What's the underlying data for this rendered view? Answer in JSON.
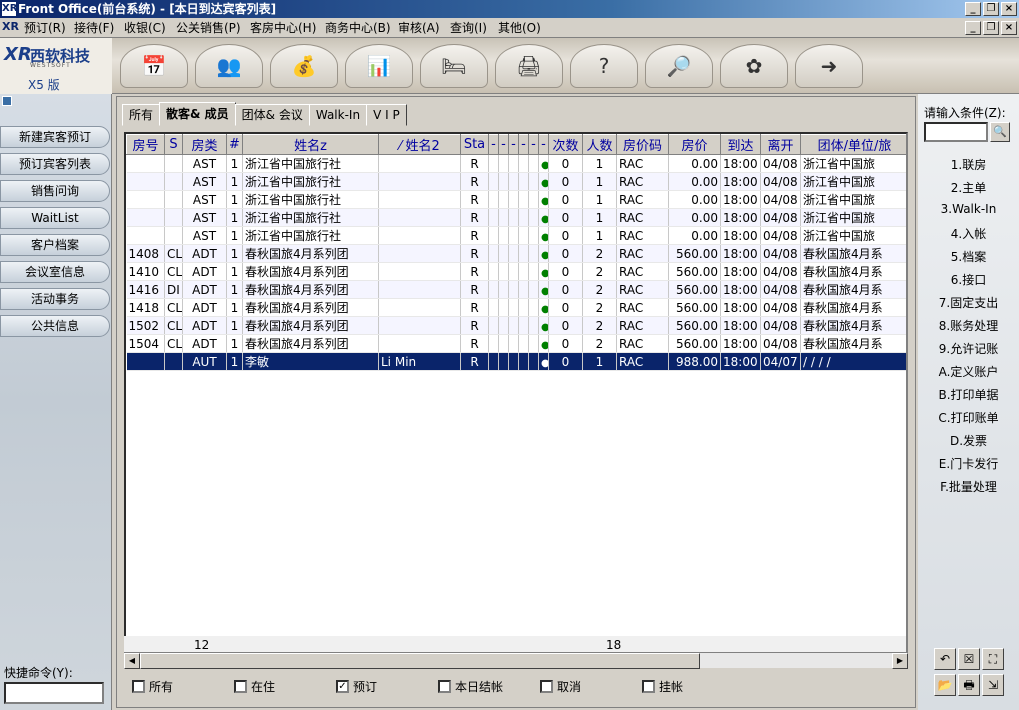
{
  "window": {
    "title": "Front Office(前台系统) - [本日到达宾客列表]"
  },
  "menu": [
    "预订(R)",
    "接待(F)",
    "收银(C)",
    "公关销售(P)",
    "客房中心(H)",
    "商务中心(B)",
    "审核(A)",
    "查询(I)",
    "其他(O)"
  ],
  "brand": {
    "name": "西软科技",
    "sub": "WESTSOFT",
    "version": "X5 版"
  },
  "toolbar_icons": [
    "reservation-icon",
    "reception-icon",
    "cashier-icon",
    "report-chart-icon",
    "room-bed-icon",
    "business-printer-icon",
    "help-icon",
    "search-query-icon",
    "settings-flower-icon",
    "exit-icon"
  ],
  "left_nav": [
    "新建宾客预订",
    "预订宾客列表",
    "销售问询",
    "WaitList",
    "客户档案",
    "会议室信息",
    "活动事务",
    "公共信息"
  ],
  "quick_cmd_label": "快捷命令(Y):",
  "tabs": [
    "所有",
    "散客& 成员",
    "团体& 会议",
    "Walk-In",
    "V I P"
  ],
  "columns": [
    "房号",
    "S",
    "房类",
    "#",
    "姓名z",
    "⁄ 姓名2",
    "Sta",
    "-",
    "-",
    "-",
    "-",
    "-",
    "-",
    "次数",
    "人数",
    "房价码",
    "房价",
    "到达",
    "离开",
    "团体/单位/旅"
  ],
  "rows": [
    {
      "room": "",
      "s": "",
      "type": "AST",
      "n": "1",
      "name": "浙江省中国旅行社",
      "name2": "",
      "sta": "R",
      "times": "0",
      "persons": "1",
      "code": "RAC",
      "rate": "0.00",
      "arr": "18:00",
      "dep": "04/08",
      "group": "浙江省中国旅"
    },
    {
      "room": "",
      "s": "",
      "type": "AST",
      "n": "1",
      "name": "浙江省中国旅行社",
      "name2": "",
      "sta": "R",
      "times": "0",
      "persons": "1",
      "code": "RAC",
      "rate": "0.00",
      "arr": "18:00",
      "dep": "04/08",
      "group": "浙江省中国旅"
    },
    {
      "room": "",
      "s": "",
      "type": "AST",
      "n": "1",
      "name": "浙江省中国旅行社",
      "name2": "",
      "sta": "R",
      "times": "0",
      "persons": "1",
      "code": "RAC",
      "rate": "0.00",
      "arr": "18:00",
      "dep": "04/08",
      "group": "浙江省中国旅"
    },
    {
      "room": "",
      "s": "",
      "type": "AST",
      "n": "1",
      "name": "浙江省中国旅行社",
      "name2": "",
      "sta": "R",
      "times": "0",
      "persons": "1",
      "code": "RAC",
      "rate": "0.00",
      "arr": "18:00",
      "dep": "04/08",
      "group": "浙江省中国旅"
    },
    {
      "room": "",
      "s": "",
      "type": "AST",
      "n": "1",
      "name": "浙江省中国旅行社",
      "name2": "",
      "sta": "R",
      "times": "0",
      "persons": "1",
      "code": "RAC",
      "rate": "0.00",
      "arr": "18:00",
      "dep": "04/08",
      "group": "浙江省中国旅"
    },
    {
      "room": "1408",
      "s": "CL",
      "type": "ADT",
      "n": "1",
      "name": "春秋国旅4月系列团",
      "name2": "",
      "sta": "R",
      "times": "0",
      "persons": "2",
      "code": "RAC",
      "rate": "560.00",
      "arr": "18:00",
      "dep": "04/08",
      "group": "春秋国旅4月系"
    },
    {
      "room": "1410",
      "s": "CL",
      "type": "ADT",
      "n": "1",
      "name": "春秋国旅4月系列团",
      "name2": "",
      "sta": "R",
      "times": "0",
      "persons": "2",
      "code": "RAC",
      "rate": "560.00",
      "arr": "18:00",
      "dep": "04/08",
      "group": "春秋国旅4月系"
    },
    {
      "room": "1416",
      "s": "DI",
      "type": "ADT",
      "n": "1",
      "name": "春秋国旅4月系列团",
      "name2": "",
      "sta": "R",
      "times": "0",
      "persons": "2",
      "code": "RAC",
      "rate": "560.00",
      "arr": "18:00",
      "dep": "04/08",
      "group": "春秋国旅4月系"
    },
    {
      "room": "1418",
      "s": "CL",
      "type": "ADT",
      "n": "1",
      "name": "春秋国旅4月系列团",
      "name2": "",
      "sta": "R",
      "times": "0",
      "persons": "2",
      "code": "RAC",
      "rate": "560.00",
      "arr": "18:00",
      "dep": "04/08",
      "group": "春秋国旅4月系"
    },
    {
      "room": "1502",
      "s": "CL",
      "type": "ADT",
      "n": "1",
      "name": "春秋国旅4月系列团",
      "name2": "",
      "sta": "R",
      "times": "0",
      "persons": "2",
      "code": "RAC",
      "rate": "560.00",
      "arr": "18:00",
      "dep": "04/08",
      "group": "春秋国旅4月系"
    },
    {
      "room": "1504",
      "s": "CL",
      "type": "ADT",
      "n": "1",
      "name": "春秋国旅4月系列团",
      "name2": "",
      "sta": "R",
      "times": "0",
      "persons": "2",
      "code": "RAC",
      "rate": "560.00",
      "arr": "18:00",
      "dep": "04/08",
      "group": "春秋国旅4月系"
    },
    {
      "room": "",
      "s": "",
      "type": "AUT",
      "n": "1",
      "name": "李敏",
      "name2": "Li Min",
      "sta": "R",
      "times": "0",
      "persons": "1",
      "code": "RAC",
      "rate": "988.00",
      "arr": "18:00",
      "dep": "04/07",
      "group": "/ / / /",
      "selected": true
    }
  ],
  "footer": {
    "count": "12",
    "persons_total": "18"
  },
  "filters": [
    {
      "label": "所有",
      "checked": false
    },
    {
      "label": "在住",
      "checked": false
    },
    {
      "label": "预订",
      "checked": true
    },
    {
      "label": "本日结帐",
      "checked": false
    },
    {
      "label": "取消",
      "checked": false
    },
    {
      "label": "挂帐",
      "checked": false
    }
  ],
  "right_panel": {
    "label": "请输入条件(Z):",
    "actions": [
      "1.联房",
      "2.主单",
      "3.Walk-In",
      "4.入帐",
      "5.档案",
      "6.接口",
      "7.固定支出",
      "8.账务处理",
      "9.允许记账",
      "A.定义账户",
      "B.打印单据",
      "C.打印账单",
      "D.发票",
      "E.门卡发行",
      "F.批量处理"
    ],
    "icons": [
      "undo-arrow-icon",
      "cancel-box-icon",
      "tree-network-icon",
      "folder-open-icon",
      "print-icon",
      "exit-door-icon"
    ]
  }
}
